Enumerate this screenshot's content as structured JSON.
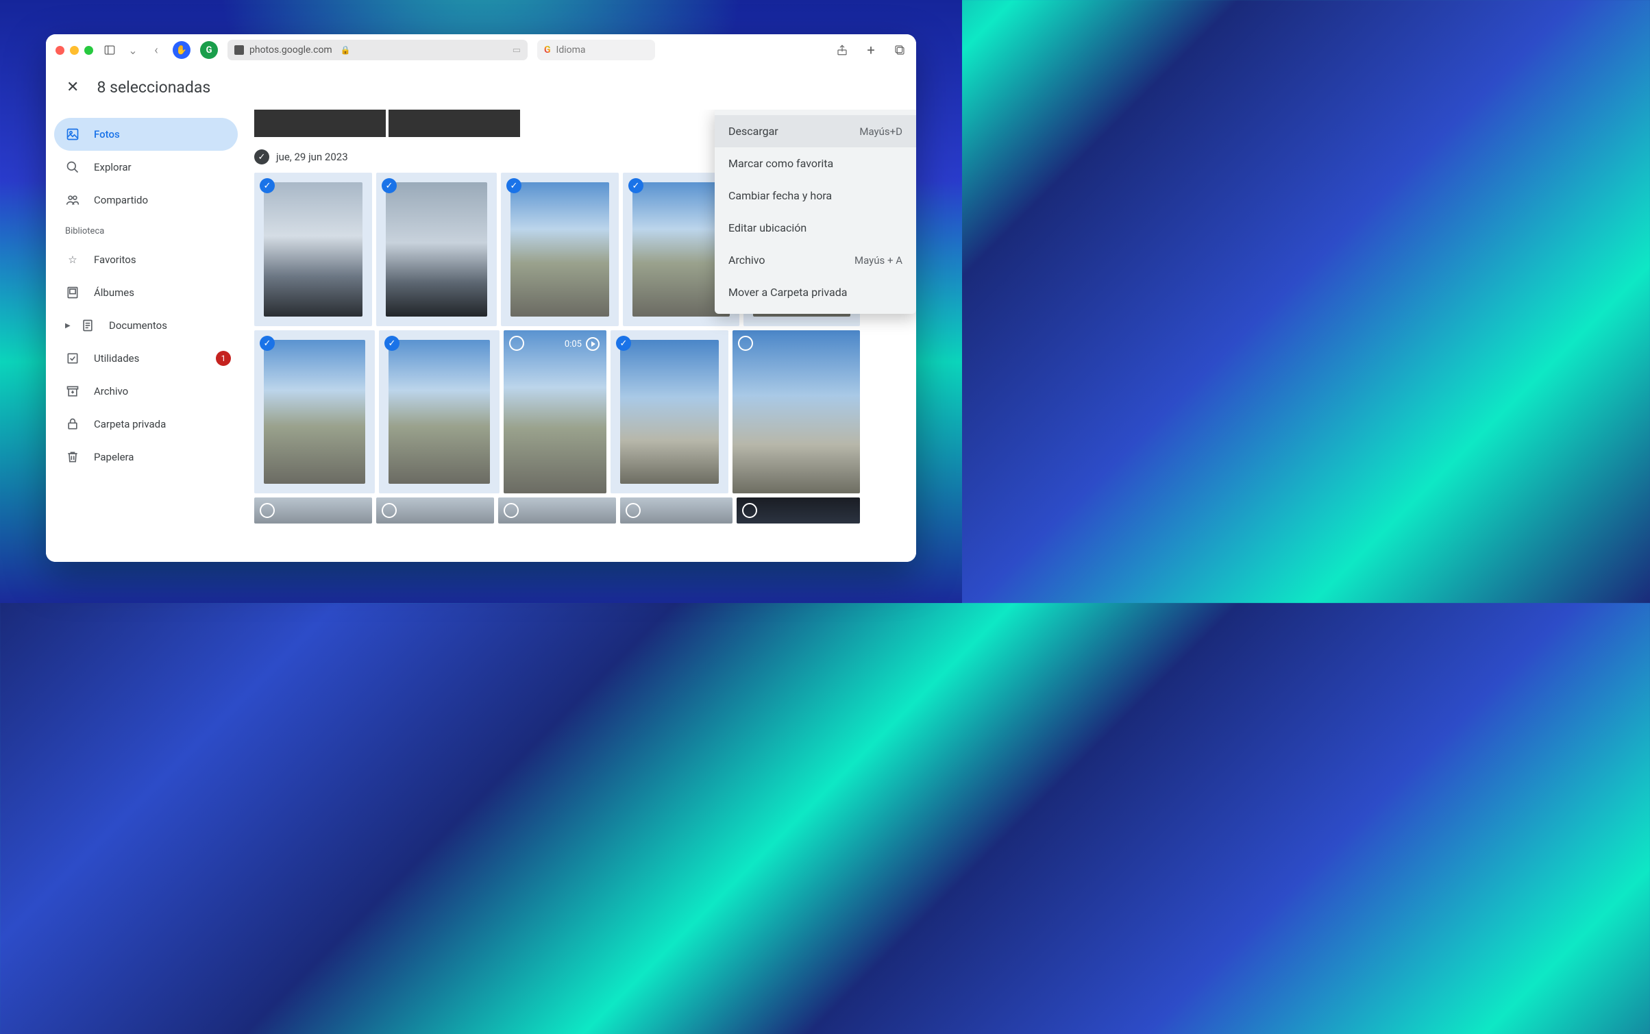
{
  "browser": {
    "url": "photos.google.com",
    "search_placeholder": "Idioma"
  },
  "selection_bar": {
    "count_text": "8 seleccionadas"
  },
  "sidebar": {
    "items": [
      {
        "label": "Fotos"
      },
      {
        "label": "Explorar"
      },
      {
        "label": "Compartido"
      }
    ],
    "library_header": "Biblioteca",
    "library": [
      {
        "label": "Favoritos"
      },
      {
        "label": "Álbumes"
      },
      {
        "label": "Documentos"
      },
      {
        "label": "Utilidades",
        "badge": "1"
      },
      {
        "label": "Archivo"
      },
      {
        "label": "Carpeta privada"
      },
      {
        "label": "Papelera"
      }
    ]
  },
  "main": {
    "date": "jue, 29 jun 2023",
    "video_duration": "0:05"
  },
  "menu": {
    "items": [
      {
        "label": "Descargar",
        "shortcut": "Mayús+D"
      },
      {
        "label": "Marcar como favorita",
        "shortcut": ""
      },
      {
        "label": "Cambiar fecha y hora",
        "shortcut": ""
      },
      {
        "label": "Editar ubicación",
        "shortcut": ""
      },
      {
        "label": "Archivo",
        "shortcut": "Mayús + A"
      },
      {
        "label": "Mover a Carpeta privada",
        "shortcut": ""
      }
    ]
  }
}
